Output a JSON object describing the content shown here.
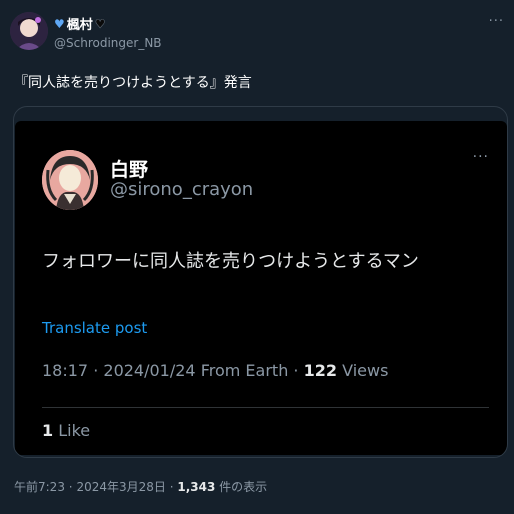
{
  "outer_tweet": {
    "display_name": "楓村",
    "handle": "@Schrodinger_NB",
    "text": "『同人誌を売りつけようとする』発言",
    "more_label": "···",
    "time": "午前7:23",
    "date": "2024年3月28日",
    "separator": "·",
    "views_count": "1,343",
    "views_label": "件の表示"
  },
  "embedded_post": {
    "display_name": "白野",
    "handle": "@sirono_crayon",
    "more_label": "···",
    "text": "フォロワーに同人誌を売りつけようとするマン",
    "translate_label": "Translate post",
    "time": "18:17",
    "date": "2024/01/24 From Earth",
    "separator": "·",
    "views_count": "122",
    "views_label": "Views",
    "likes_count": "1",
    "likes_label": "Like"
  },
  "icons": {
    "name_prefix": "blue-heart-icon",
    "name_suffix": "black-heart-icon",
    "more": "more-options-icon"
  },
  "colors": {
    "background": "#15202b",
    "embedded_background": "#000000",
    "link": "#1d9bf0",
    "muted": "#8b98a5"
  }
}
